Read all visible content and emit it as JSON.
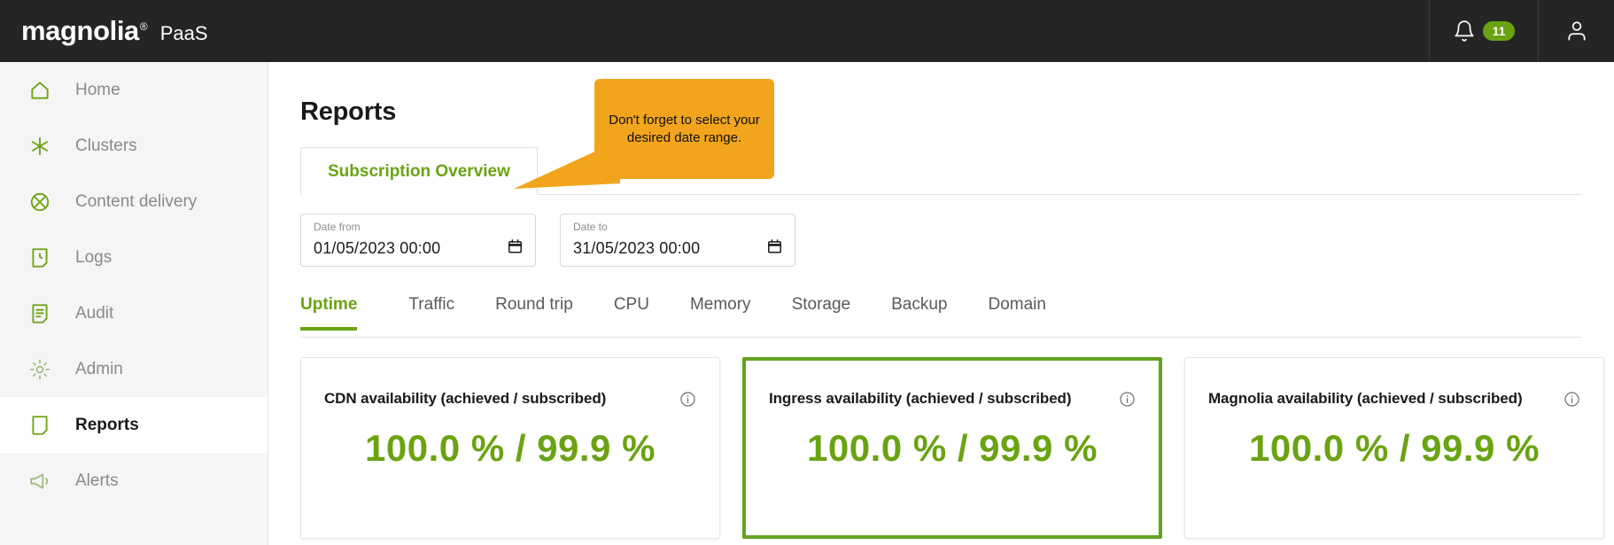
{
  "topbar": {
    "brand_name": "magnolia",
    "brand_reg": "®",
    "brand_sub": "PaaS",
    "notifications_icon": "bell-icon",
    "notifications_count": "11",
    "account_icon": "user-avatar-icon"
  },
  "sidebar": {
    "items": [
      {
        "label": "Home",
        "icon": "home-icon",
        "active": false
      },
      {
        "label": "Clusters",
        "icon": "asterisk-icon",
        "active": false
      },
      {
        "label": "Content delivery",
        "icon": "globe-crossed-icon",
        "active": false
      },
      {
        "label": "Logs",
        "icon": "document-clock-icon",
        "active": false
      },
      {
        "label": "Audit",
        "icon": "document-list-icon",
        "active": false
      },
      {
        "label": "Admin",
        "icon": "gear-icon",
        "active": false
      },
      {
        "label": "Reports",
        "icon": "document-icon",
        "active": true
      },
      {
        "label": "Alerts",
        "icon": "megaphone-icon",
        "active": false
      }
    ]
  },
  "main": {
    "page_title": "Reports",
    "top_tabs": [
      {
        "label": "Subscription Overview",
        "active": true
      }
    ],
    "date_from": {
      "label": "Date from",
      "value": "01/05/2023 00:00",
      "icon": "calendar-icon"
    },
    "date_to": {
      "label": "Date to",
      "value": "31/05/2023 00:00",
      "icon": "calendar-icon"
    },
    "metric_tabs": [
      {
        "label": "Uptime",
        "active": true
      },
      {
        "label": "Traffic",
        "active": false
      },
      {
        "label": "Round trip",
        "active": false
      },
      {
        "label": "CPU",
        "active": false
      },
      {
        "label": "Memory",
        "active": false
      },
      {
        "label": "Storage",
        "active": false
      },
      {
        "label": "Backup",
        "active": false
      },
      {
        "label": "Domain",
        "active": false
      }
    ],
    "cards": [
      {
        "title": "CDN availability (achieved / subscribed)",
        "value": "100.0 % / 99.9 %",
        "info_icon": "info-icon",
        "highlighted": false
      },
      {
        "title": "Ingress availability (achieved / subscribed)",
        "value": "100.0 % / 99.9 %",
        "info_icon": "info-icon",
        "highlighted": true
      },
      {
        "title": "Magnolia availability (achieved / subscribed)",
        "value": "100.0 % / 99.9 %",
        "info_icon": "info-icon",
        "highlighted": false
      }
    ]
  },
  "callout": {
    "text": "Don't forget to select your desired date range."
  },
  "colors": {
    "accent_green": "#6aa312",
    "highlight_green": "#63a420",
    "callout_orange": "#f2a51c",
    "topbar_dark": "#252525",
    "sidebar_gray": "#f5f5f5"
  }
}
